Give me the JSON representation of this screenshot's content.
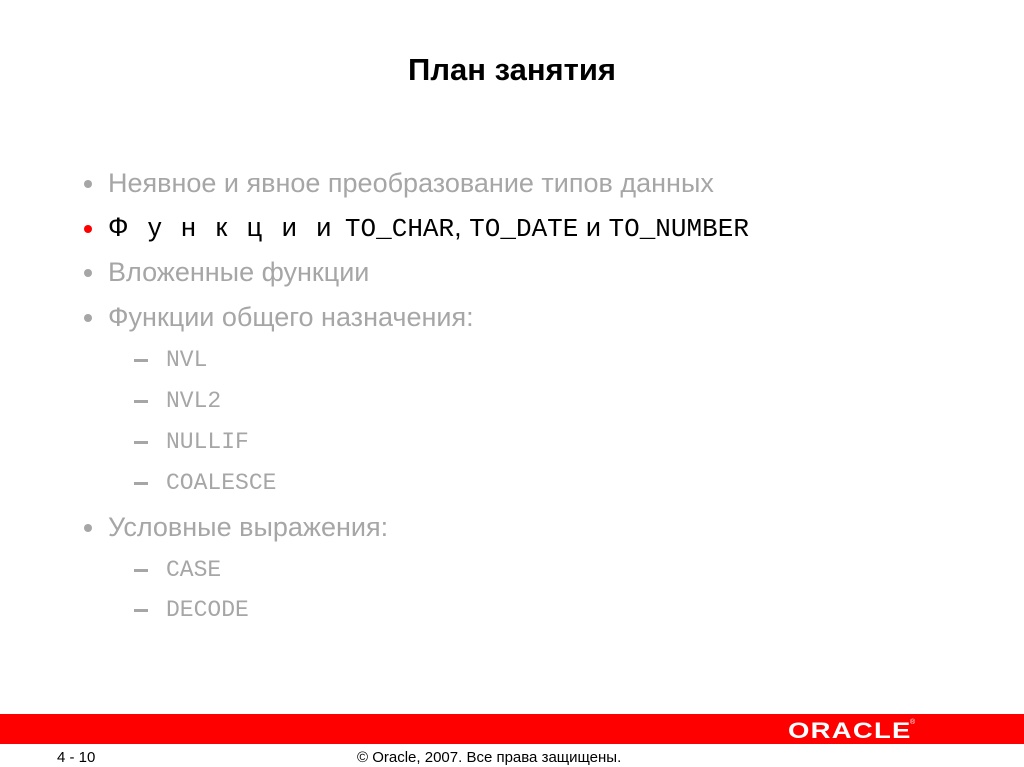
{
  "slide": {
    "title": "План занятия",
    "items": [
      {
        "text": "Неявное и явное преобразование типов данных",
        "active": false
      },
      {
        "prefix": "Ф у н к ц и и",
        "code1": "TO_CHAR",
        "sep1": ",",
        "code2": "TO_DATE",
        "conj": "и",
        "code3": "TO_NUMBER",
        "active": true
      },
      {
        "text": "Вложенные функции",
        "active": false
      },
      {
        "text": "Функции общего назначения:",
        "active": false,
        "subitems": [
          "NVL",
          "NVL2",
          "NULLIF",
          "COALESCE"
        ]
      },
      {
        "text": "Условные выражения:",
        "active": false,
        "subitems": [
          "CASE",
          "DECODE"
        ]
      }
    ]
  },
  "footer": {
    "logo": "ORACLE",
    "logo_mark": "®",
    "page_number": "4 - 10",
    "copyright": "© Oracle, 2007. Все права защищены."
  },
  "colors": {
    "accent_red": "#ff0000",
    "inactive_text": "#a6a6a6",
    "active_text": "#000000"
  }
}
